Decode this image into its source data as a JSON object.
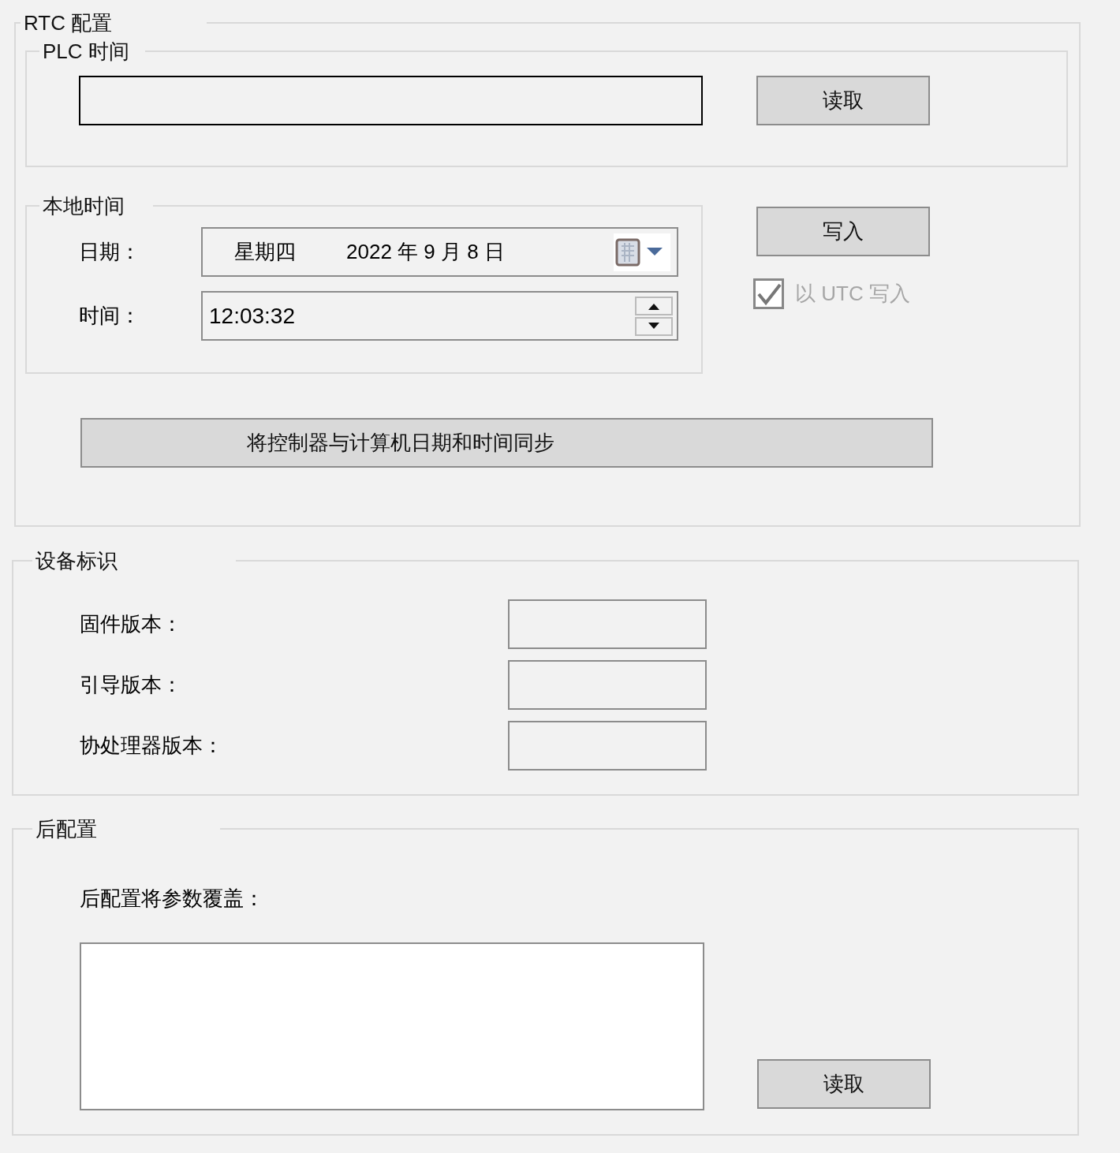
{
  "rtc_config": {
    "title": "RTC 配置",
    "plc_time": {
      "title": "PLC 时间",
      "read_button": "读取"
    },
    "local_time": {
      "title": "本地时间",
      "date_label": "日期：",
      "date_weekday": "星期四",
      "date_value": "2022 年 9 月 8 日",
      "time_label": "时间：",
      "time_value": "12:03:32"
    },
    "write_button": "写入",
    "utc_checkbox": {
      "label": "以 UTC 写入",
      "checked": true,
      "disabled": true
    },
    "sync_button": "将控制器与计算机日期和时间同步"
  },
  "device_id": {
    "title": "设备标识",
    "fields": [
      {
        "label": "固件版本："
      },
      {
        "label": "引导版本："
      },
      {
        "label": "协处理器版本："
      }
    ]
  },
  "post_config": {
    "title": "后配置",
    "label": "后配置将参数覆盖：",
    "read_button": "读取"
  }
}
